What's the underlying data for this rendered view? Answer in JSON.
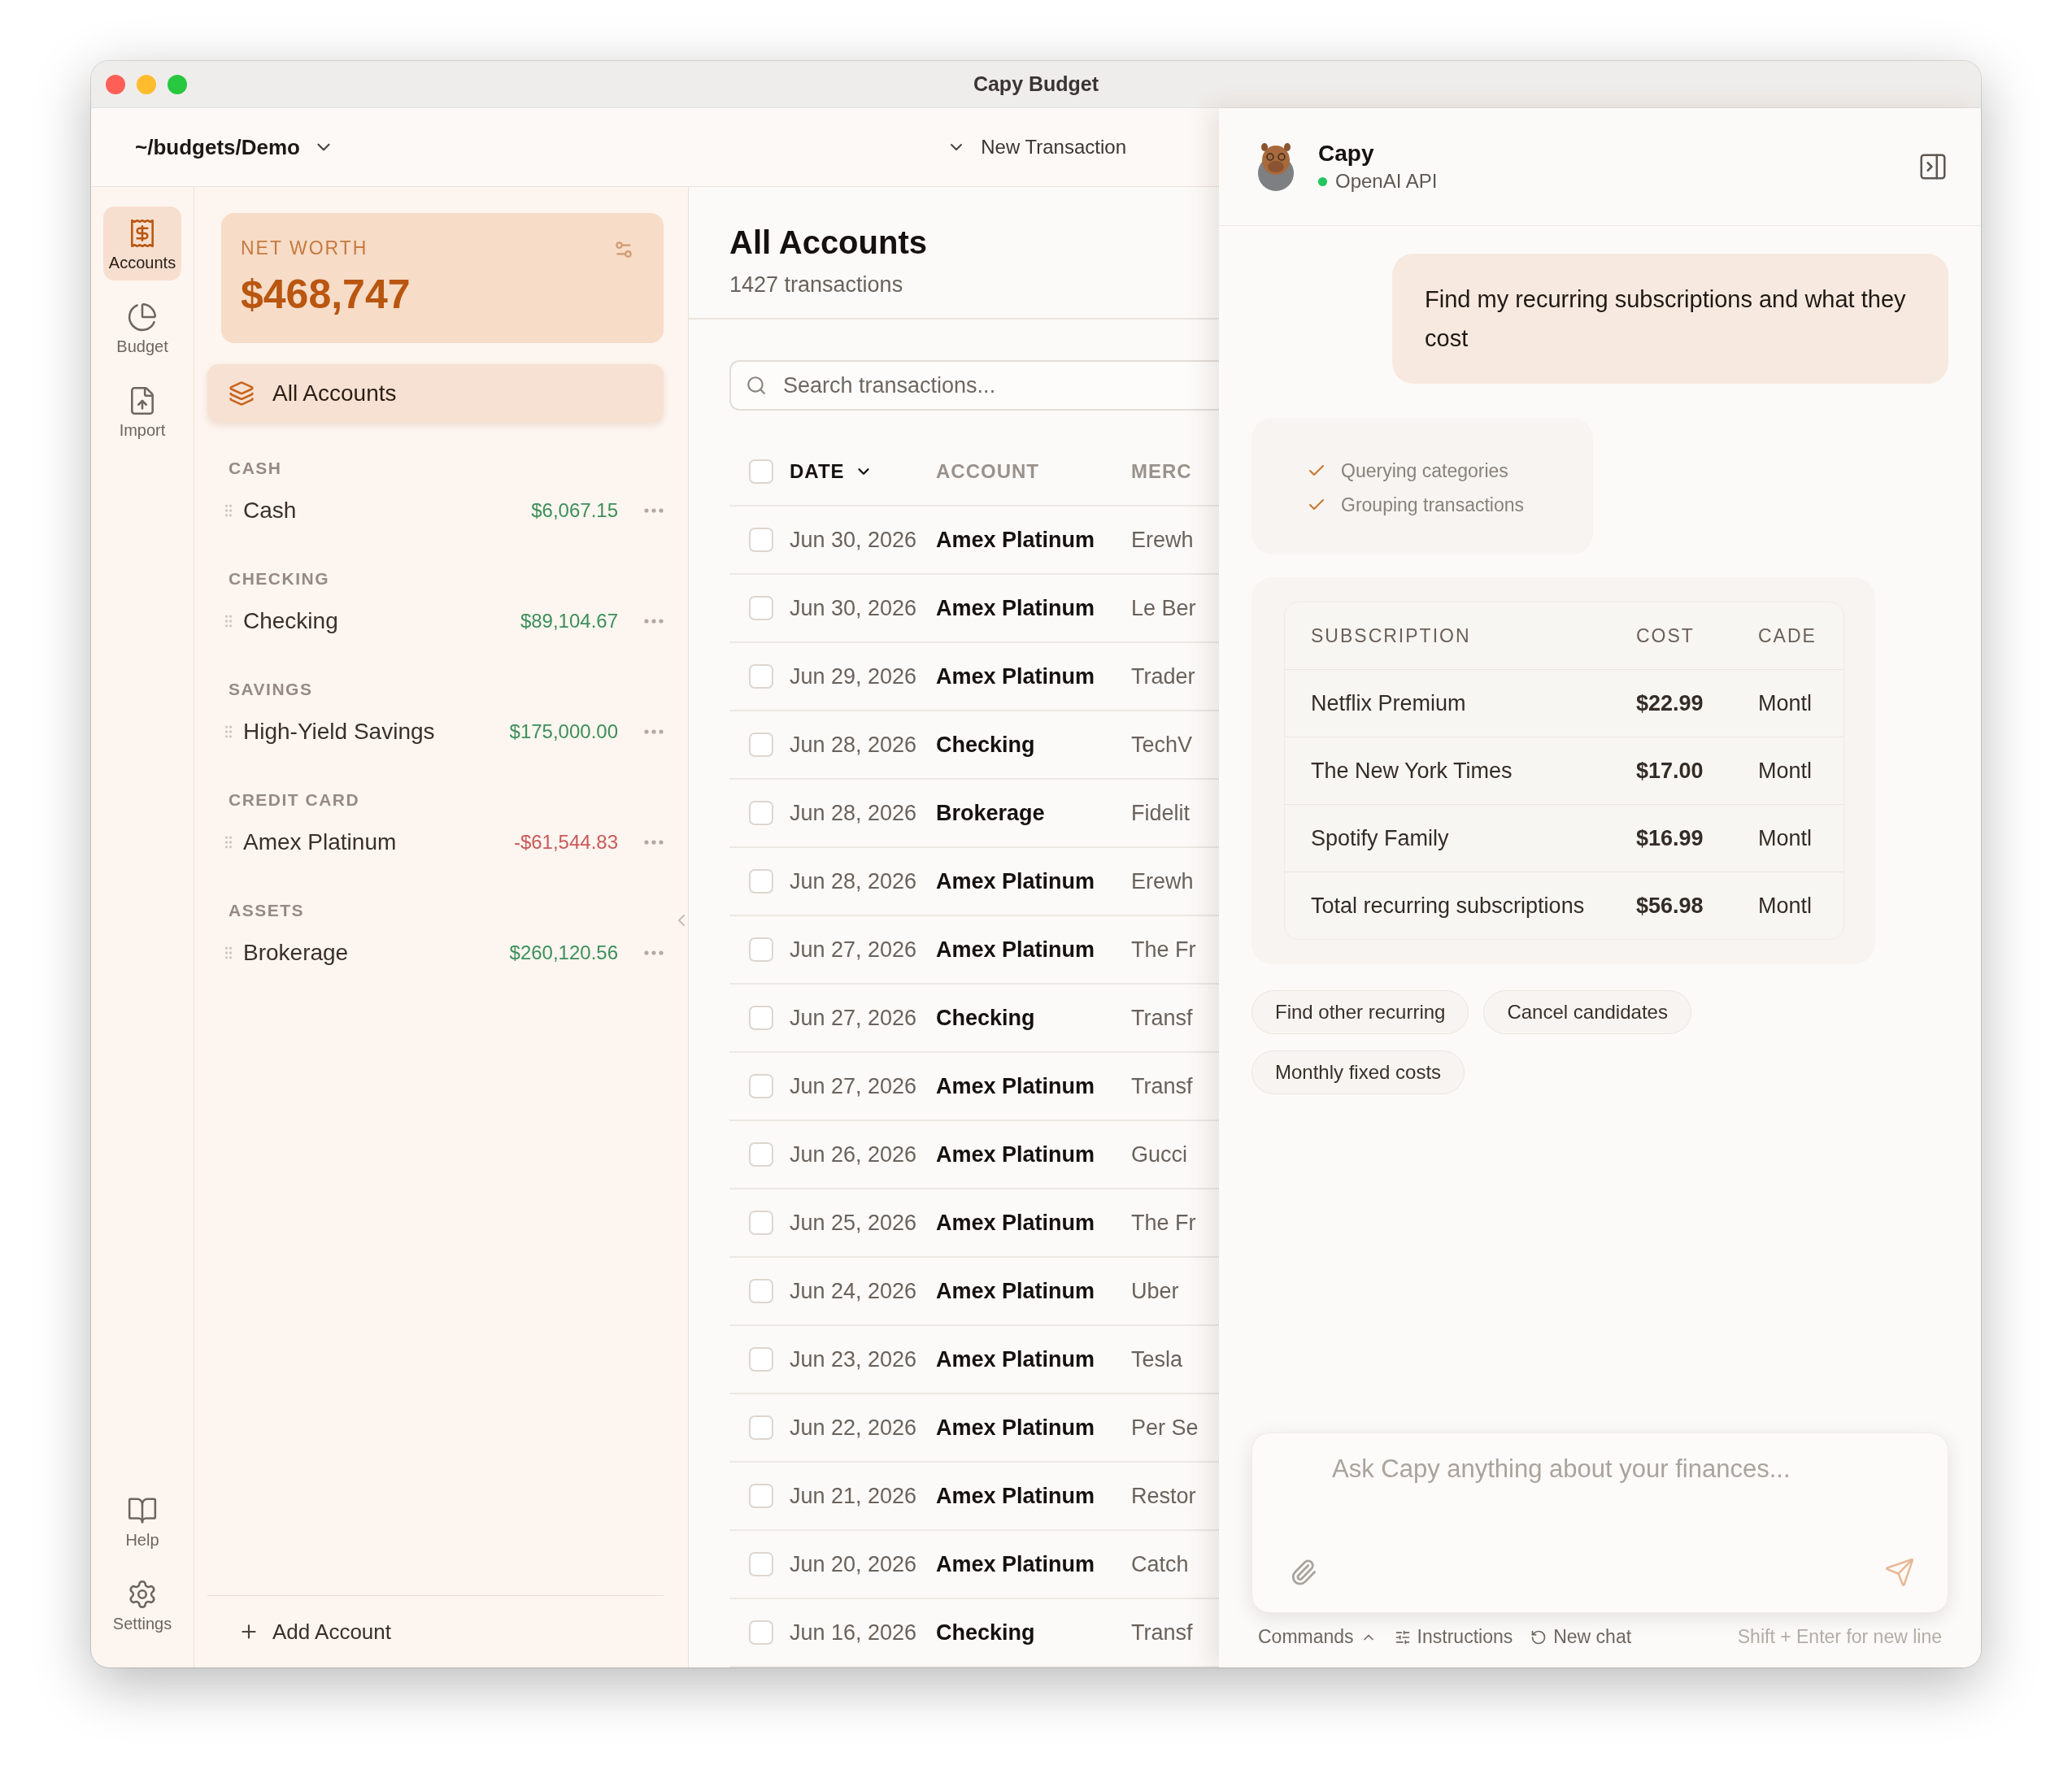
{
  "window": {
    "title": "Capy Budget"
  },
  "toolbar": {
    "budget_path": "~/budgets/Demo",
    "new_transaction": "New Transaction"
  },
  "rail": {
    "items": [
      {
        "label": "Accounts",
        "selected": true
      },
      {
        "label": "Budget",
        "selected": false
      },
      {
        "label": "Import",
        "selected": false
      }
    ],
    "bottom_items": [
      {
        "label": "Help"
      },
      {
        "label": "Settings"
      }
    ]
  },
  "net_worth": {
    "label": "NET WORTH",
    "value": "$468,747"
  },
  "all_accounts": {
    "label": "All Accounts",
    "selected": true
  },
  "account_groups": [
    {
      "heading": "CASH",
      "accounts": [
        {
          "name": "Cash",
          "balance": "$6,067.15",
          "color": "#3d8f5c"
        }
      ]
    },
    {
      "heading": "CHECKING",
      "accounts": [
        {
          "name": "Checking",
          "balance": "$89,104.67",
          "color": "#3d8f5c"
        }
      ]
    },
    {
      "heading": "SAVINGS",
      "accounts": [
        {
          "name": "High-Yield Savings",
          "balance": "$175,000.00",
          "color": "#3d8f5c"
        }
      ]
    },
    {
      "heading": "CREDIT CARD",
      "accounts": [
        {
          "name": "Amex Platinum",
          "balance": "-$61,544.83",
          "color": "#c9595a"
        }
      ]
    },
    {
      "heading": "ASSETS",
      "accounts": [
        {
          "name": "Brokerage",
          "balance": "$260,120.56",
          "color": "#3d8f5c"
        }
      ]
    }
  ],
  "add_account": "Add Account",
  "main": {
    "title": "All Accounts",
    "subtitle": "1427 transactions",
    "search_placeholder": "Search transactions...",
    "select_all_checked": false,
    "columns": [
      {
        "label": "DATE",
        "sorted": true
      },
      {
        "label": "ACCOUNT",
        "sorted": false
      },
      {
        "label": "MERC",
        "sorted": false
      }
    ],
    "rows": [
      {
        "date": "Jun 30, 2026",
        "account": "Amex Platinum",
        "merchant": "Erewh",
        "checked": false
      },
      {
        "date": "Jun 30, 2026",
        "account": "Amex Platinum",
        "merchant": "Le Ber",
        "checked": false
      },
      {
        "date": "Jun 29, 2026",
        "account": "Amex Platinum",
        "merchant": "Trader",
        "checked": false
      },
      {
        "date": "Jun 28, 2026",
        "account": "Checking",
        "merchant": "TechV",
        "checked": false
      },
      {
        "date": "Jun 28, 2026",
        "account": "Brokerage",
        "merchant": "Fidelit",
        "checked": false
      },
      {
        "date": "Jun 28, 2026",
        "account": "Amex Platinum",
        "merchant": "Erewh",
        "checked": false
      },
      {
        "date": "Jun 27, 2026",
        "account": "Amex Platinum",
        "merchant": "The Fr",
        "checked": false
      },
      {
        "date": "Jun 27, 2026",
        "account": "Checking",
        "merchant": "Transf",
        "checked": false
      },
      {
        "date": "Jun 27, 2026",
        "account": "Amex Platinum",
        "merchant": "Transf",
        "checked": false
      },
      {
        "date": "Jun 26, 2026",
        "account": "Amex Platinum",
        "merchant": "Gucci",
        "checked": false
      },
      {
        "date": "Jun 25, 2026",
        "account": "Amex Platinum",
        "merchant": "The Fr",
        "checked": false
      },
      {
        "date": "Jun 24, 2026",
        "account": "Amex Platinum",
        "merchant": "Uber",
        "checked": false
      },
      {
        "date": "Jun 23, 2026",
        "account": "Amex Platinum",
        "merchant": "Tesla",
        "checked": false
      },
      {
        "date": "Jun 22, 2026",
        "account": "Amex Platinum",
        "merchant": "Per Se",
        "checked": false
      },
      {
        "date": "Jun 21, 2026",
        "account": "Amex Platinum",
        "merchant": "Restor",
        "checked": false
      },
      {
        "date": "Jun 20, 2026",
        "account": "Amex Platinum",
        "merchant": "Catch",
        "checked": false
      },
      {
        "date": "Jun 16, 2026",
        "account": "Checking",
        "merchant": "Transf",
        "checked": false
      }
    ]
  },
  "chat": {
    "name": "Capy",
    "status": "OpenAI API",
    "online": true,
    "user_message": "Find my recurring subscriptions and what they cost",
    "steps": [
      {
        "label": "Querying categories",
        "done": true
      },
      {
        "label": "Grouping transactions",
        "done": true
      }
    ],
    "table": {
      "columns": [
        "SUBSCRIPTION",
        "COST",
        "CADE"
      ],
      "rows": [
        [
          "Netflix Premium",
          "$22.99",
          "Montl"
        ],
        [
          "The New York Times",
          "$17.00",
          "Montl"
        ],
        [
          "Spotify Family",
          "$16.99",
          "Montl"
        ],
        [
          "Total recurring subscriptions",
          "$56.98",
          "Montl"
        ]
      ]
    },
    "suggestions": [
      "Find other recurring",
      "Cancel candidates",
      "Monthly fixed costs"
    ],
    "composer_placeholder": "Ask Capy anything about your finances...",
    "footer": {
      "commands": "Commands",
      "instructions": "Instructions",
      "new_chat": "New chat",
      "hint": "Shift + Enter for new line"
    }
  }
}
